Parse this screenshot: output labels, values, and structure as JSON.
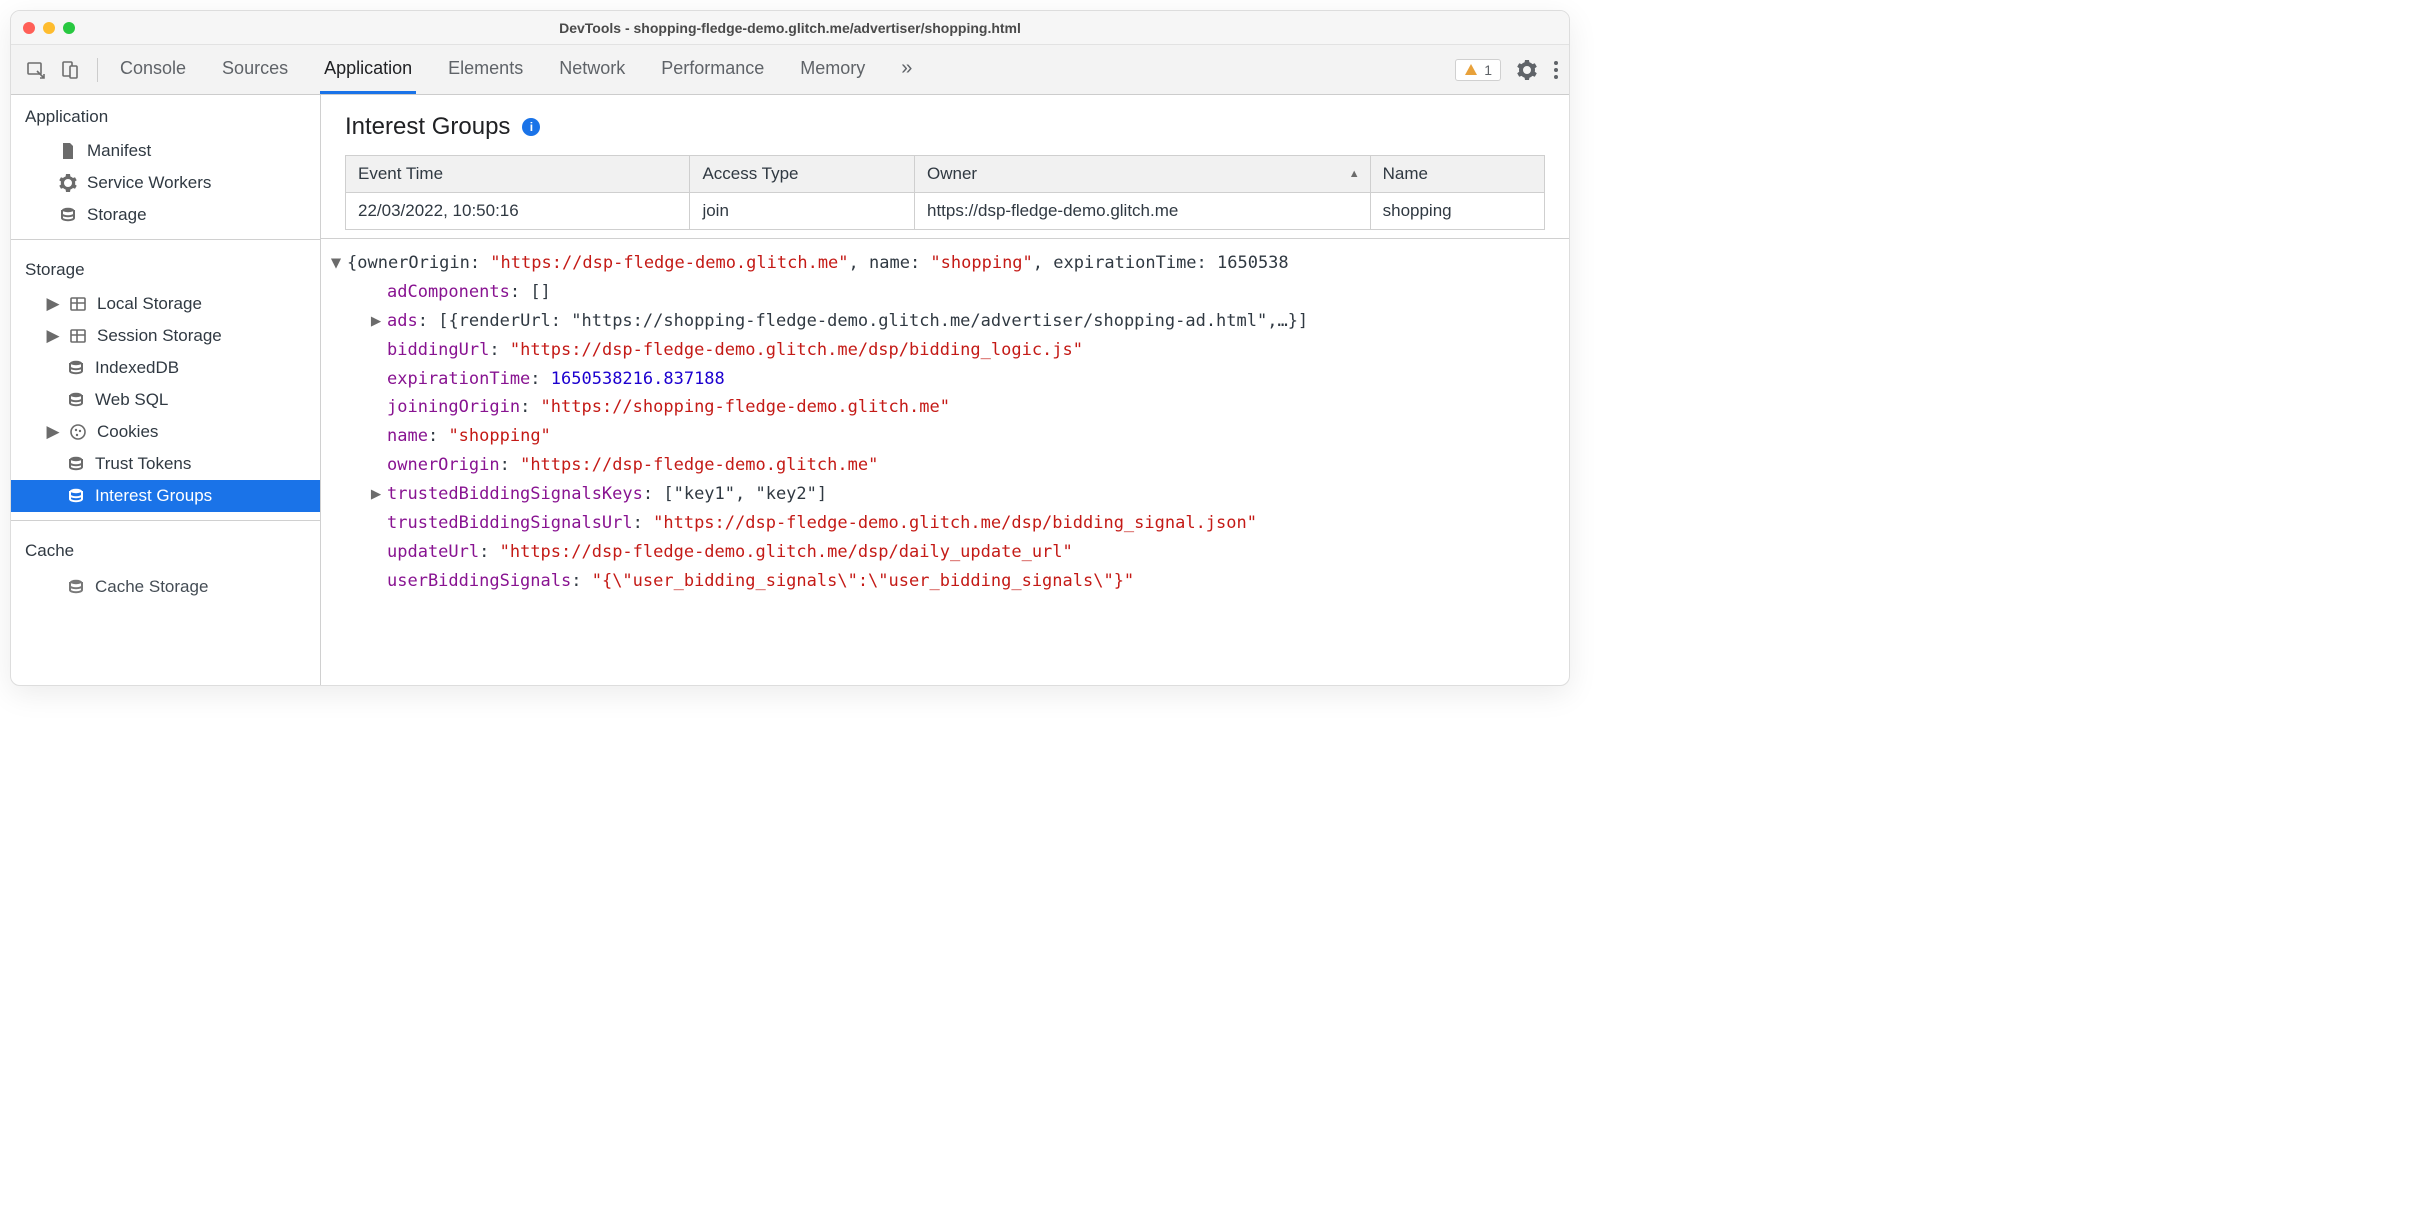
{
  "window": {
    "title": "DevTools - shopping-fledge-demo.glitch.me/advertiser/shopping.html"
  },
  "toolbar": {
    "tabs": [
      "Console",
      "Sources",
      "Application",
      "Elements",
      "Network",
      "Performance",
      "Memory"
    ],
    "active_tab": "Application",
    "warning_count": "1"
  },
  "sidebar": {
    "sections": [
      {
        "title": "Application",
        "items": [
          {
            "label": "Manifest",
            "icon": "file"
          },
          {
            "label": "Service Workers",
            "icon": "gear"
          },
          {
            "label": "Storage",
            "icon": "db"
          }
        ]
      },
      {
        "title": "Storage",
        "items": [
          {
            "label": "Local Storage",
            "icon": "grid",
            "expandable": true
          },
          {
            "label": "Session Storage",
            "icon": "grid",
            "expandable": true
          },
          {
            "label": "IndexedDB",
            "icon": "db"
          },
          {
            "label": "Web SQL",
            "icon": "db"
          },
          {
            "label": "Cookies",
            "icon": "cookie",
            "expandable": true
          },
          {
            "label": "Trust Tokens",
            "icon": "db"
          },
          {
            "label": "Interest Groups",
            "icon": "db",
            "selected": true
          }
        ]
      },
      {
        "title": "Cache",
        "items": [
          {
            "label": "Cache Storage",
            "icon": "db"
          }
        ]
      }
    ]
  },
  "panel": {
    "title": "Interest Groups",
    "table": {
      "headers": [
        "Event Time",
        "Access Type",
        "Owner",
        "Name"
      ],
      "sort_col": 2,
      "rows": [
        [
          "22/03/2022, 10:50:16",
          "join",
          "https://dsp-fledge-demo.glitch.me",
          "shopping"
        ]
      ]
    },
    "details": {
      "summary_prefix": "{ownerOrigin: ",
      "summary_owner": "\"https://dsp-fledge-demo.glitch.me\"",
      "summary_mid1": ", name: ",
      "summary_name": "\"shopping\"",
      "summary_mid2": ", expirationTime: 1650538",
      "props": [
        {
          "k": "adComponents",
          "v": "[]",
          "t": "plain"
        },
        {
          "k": "ads",
          "v": "[{renderUrl: \"https://shopping-fledge-demo.glitch.me/advertiser/shopping-ad.html\",…}]",
          "t": "plain",
          "caret": true
        },
        {
          "k": "biddingUrl",
          "v": "\"https://dsp-fledge-demo.glitch.me/dsp/bidding_logic.js\"",
          "t": "str"
        },
        {
          "k": "expirationTime",
          "v": "1650538216.837188",
          "t": "num"
        },
        {
          "k": "joiningOrigin",
          "v": "\"https://shopping-fledge-demo.glitch.me\"",
          "t": "str"
        },
        {
          "k": "name",
          "v": "\"shopping\"",
          "t": "str"
        },
        {
          "k": "ownerOrigin",
          "v": "\"https://dsp-fledge-demo.glitch.me\"",
          "t": "str"
        },
        {
          "k": "trustedBiddingSignalsKeys",
          "v": "[\"key1\", \"key2\"]",
          "t": "plain",
          "caret": true
        },
        {
          "k": "trustedBiddingSignalsUrl",
          "v": "\"https://dsp-fledge-demo.glitch.me/dsp/bidding_signal.json\"",
          "t": "str"
        },
        {
          "k": "updateUrl",
          "v": "\"https://dsp-fledge-demo.glitch.me/dsp/daily_update_url\"",
          "t": "str"
        },
        {
          "k": "userBiddingSignals",
          "v": "\"{\\\"user_bidding_signals\\\":\\\"user_bidding_signals\\\"}\"",
          "t": "str"
        }
      ]
    }
  }
}
